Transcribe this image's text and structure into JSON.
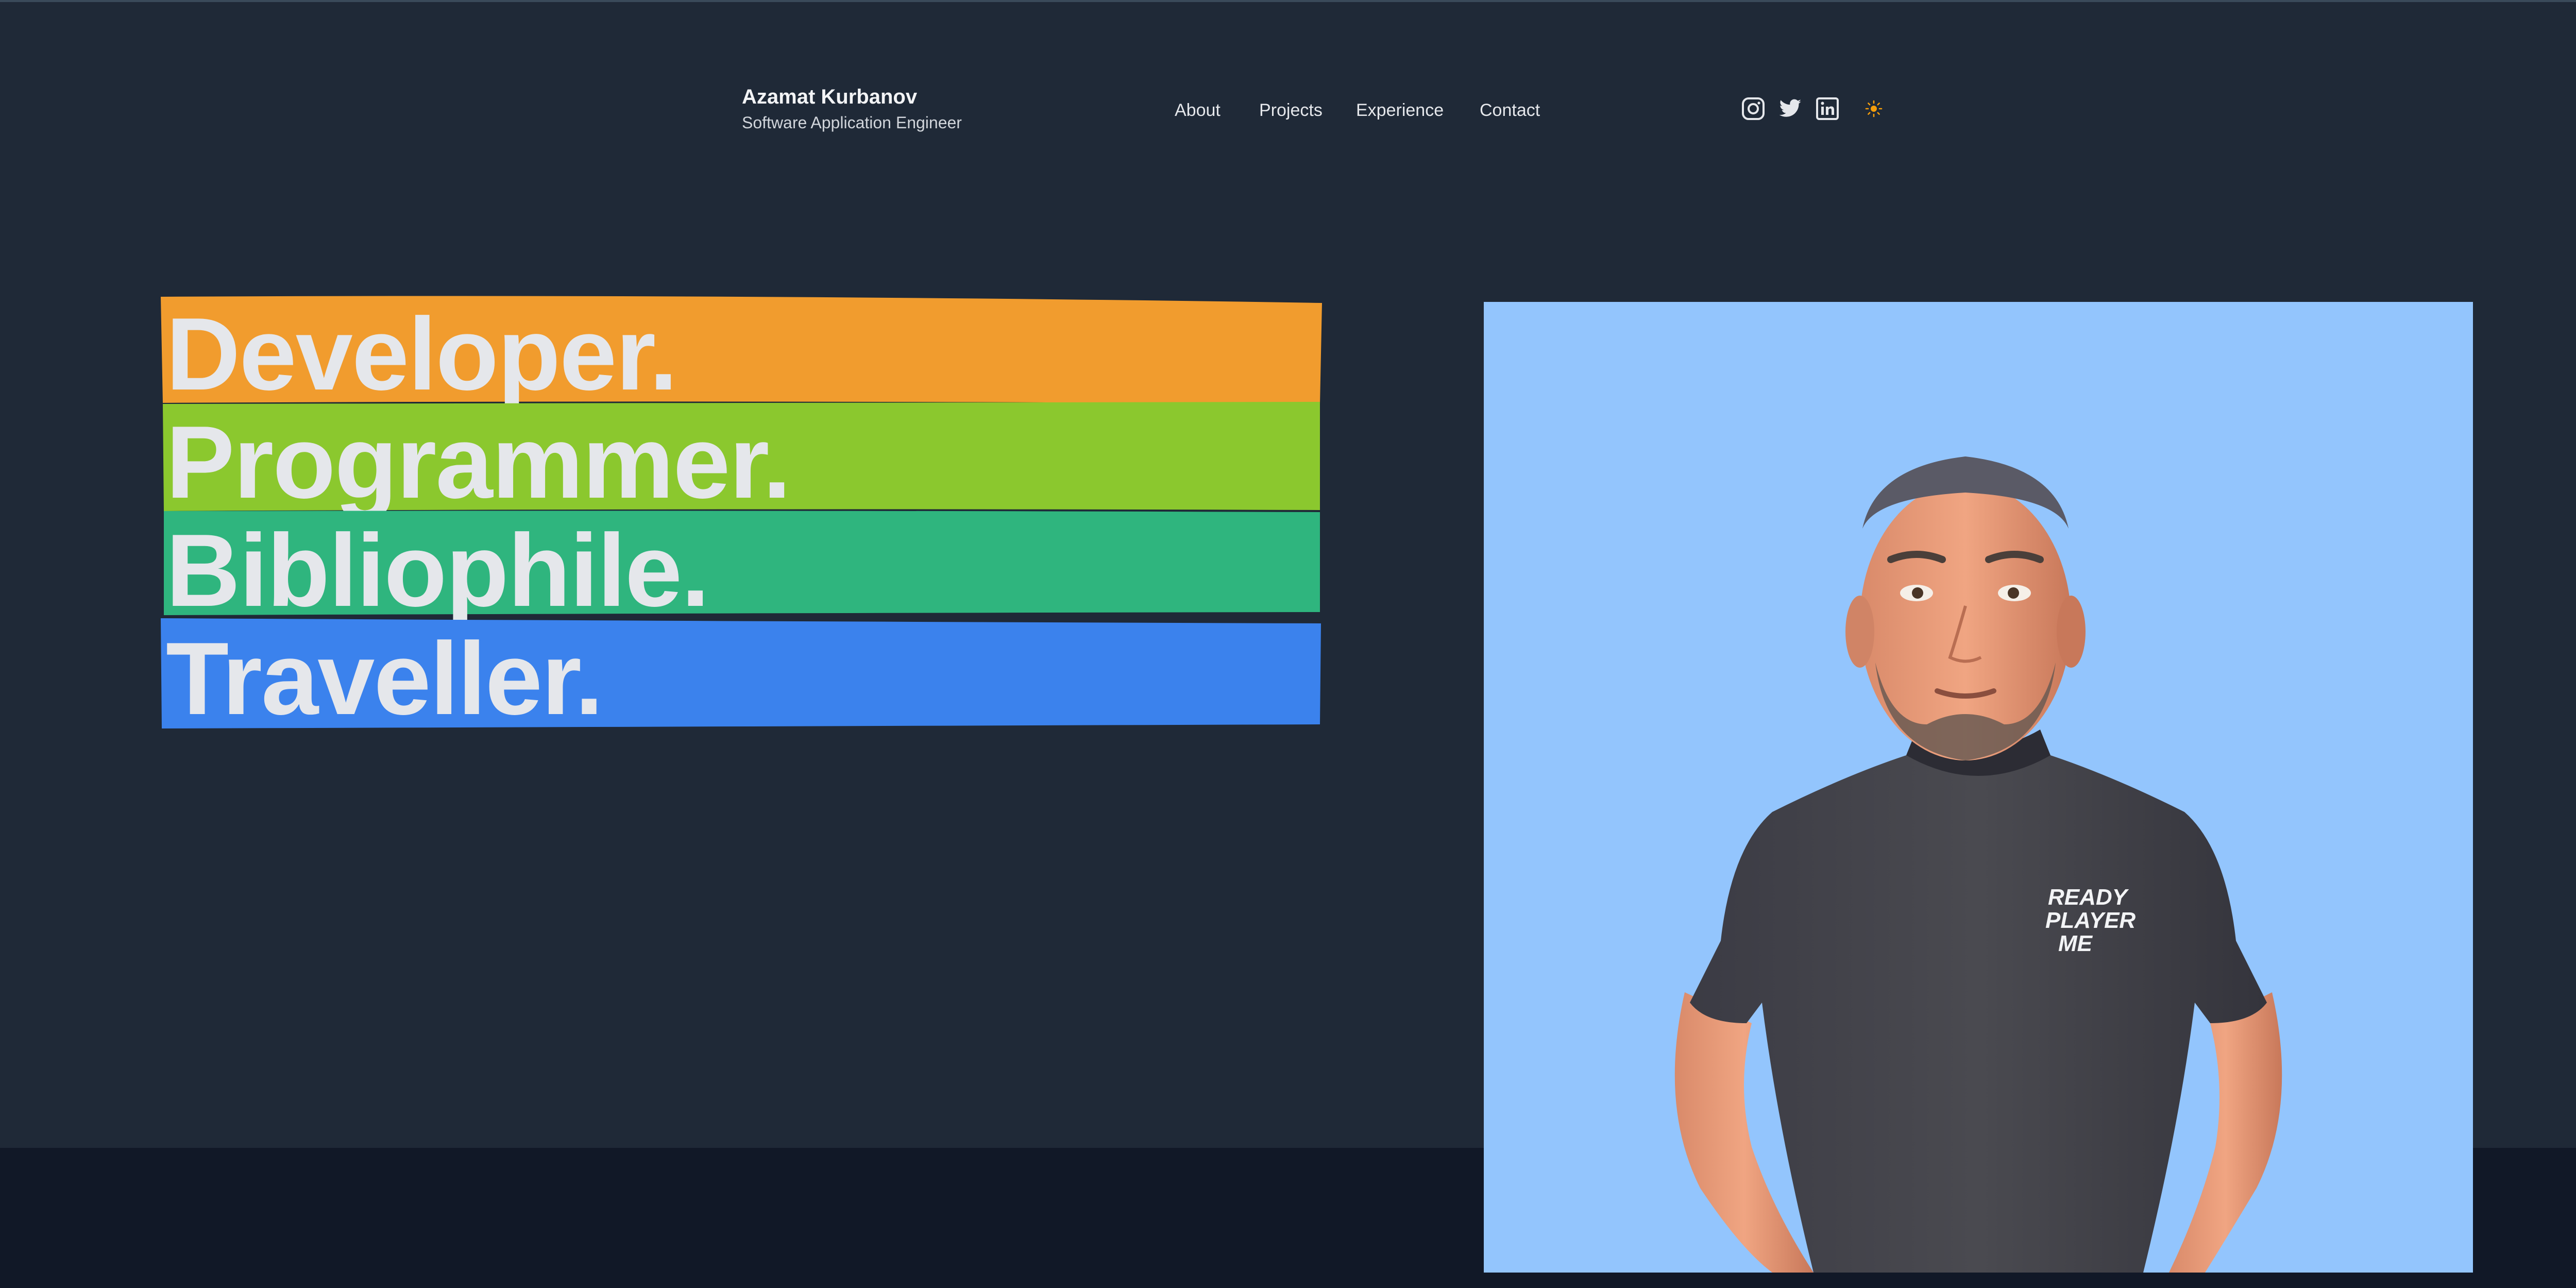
{
  "header": {
    "name": "Azamat Kurbanov",
    "role": "Software Application Engineer"
  },
  "nav": {
    "items": [
      {
        "label": "About"
      },
      {
        "label": "Projects"
      },
      {
        "label": "Experience"
      },
      {
        "label": "Contact"
      }
    ]
  },
  "social": {
    "icons": [
      "instagram-icon",
      "twitter-icon",
      "linkedin-icon",
      "sun-icon"
    ]
  },
  "hero": {
    "words": [
      {
        "text": "Developer.",
        "color": "#f19c2e"
      },
      {
        "text": "Programmer.",
        "color": "#8bc82e"
      },
      {
        "text": "Bibliophile.",
        "color": "#2fb57e"
      },
      {
        "text": "Traveller.",
        "color": "#3b82ed"
      }
    ]
  },
  "avatar": {
    "shirt_text": [
      "READY",
      "PLAYER",
      "ME"
    ],
    "background": "#93c5fd"
  },
  "colors": {
    "page_background": "#1f2937",
    "footer_background": "#111827",
    "text_light": "#e5e7eb",
    "sun_accent": "#f59e0b"
  }
}
